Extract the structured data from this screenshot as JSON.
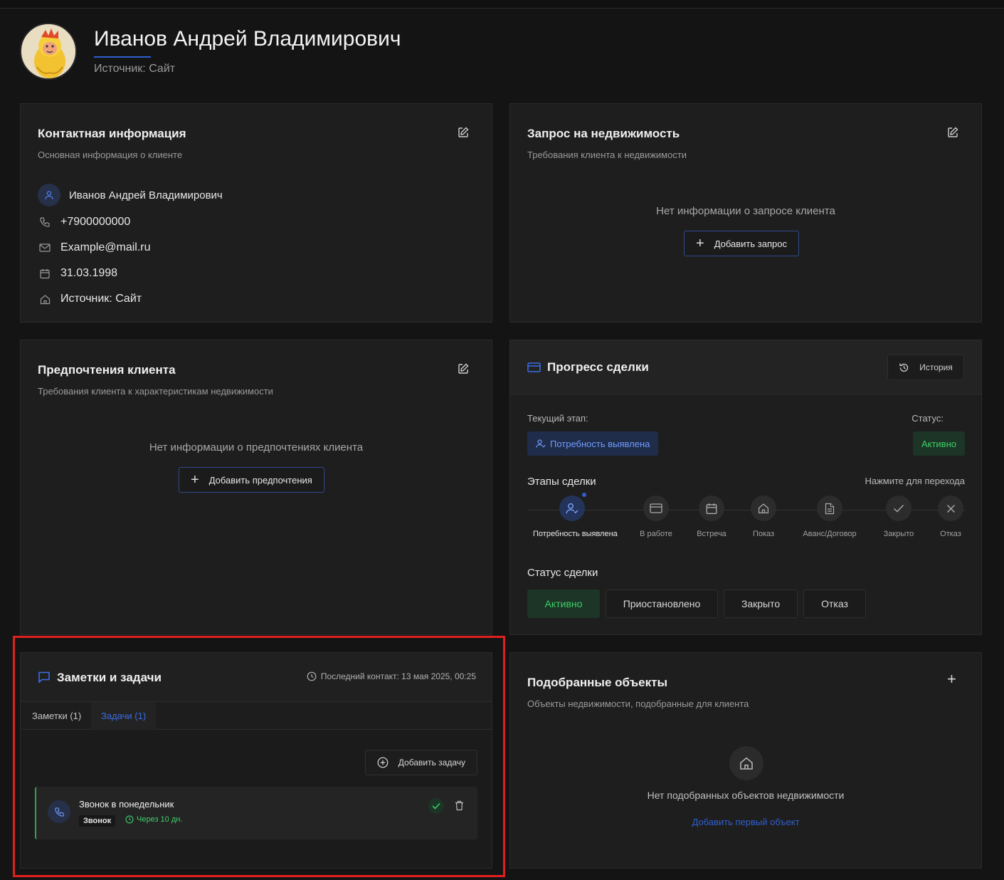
{
  "client": {
    "full_name": "Иванов Андрей Владимирович",
    "source_label": "Источник: Сайт"
  },
  "contact_card": {
    "title": "Контактная информация",
    "subtitle": "Основная информация о клиенте",
    "name": "Иванов Андрей Владимирович",
    "phone": "+7900000000",
    "email": "Example@mail.ru",
    "birthdate": "31.03.1998",
    "source": "Источник: Сайт"
  },
  "request_card": {
    "title": "Запрос на недвижимость",
    "subtitle": "Требования клиента к недвижимости",
    "empty_text": "Нет информации о запросе клиента",
    "add_label": "Добавить запрос"
  },
  "prefs_card": {
    "title": "Предпочтения клиента",
    "subtitle": "Требования клиента к характеристикам недвижимости",
    "empty_text": "Нет информации о предпочтениях клиента",
    "add_label": "Добавить предпочтения"
  },
  "progress_card": {
    "title": "Прогресс сделки",
    "history_label": "История",
    "current_stage_label": "Текущий этап:",
    "current_stage_value": "Потребность выявлена",
    "status_label": "Статус:",
    "status_value": "Активно",
    "stages_title": "Этапы сделки",
    "stages_hint": "Нажмите для перехода",
    "stages": [
      {
        "label": "Потребность выявлена",
        "icon": "user-check-icon",
        "active": true
      },
      {
        "label": "В работе",
        "icon": "card-icon",
        "active": false
      },
      {
        "label": "Встреча",
        "icon": "calendar-icon",
        "active": false
      },
      {
        "label": "Показ",
        "icon": "home-icon",
        "active": false
      },
      {
        "label": "Аванс/Договор",
        "icon": "document-icon",
        "active": false
      },
      {
        "label": "Закрыто",
        "icon": "check-icon",
        "active": false
      },
      {
        "label": "Отказ",
        "icon": "close-icon",
        "active": false
      }
    ],
    "deal_status_title": "Статус сделки",
    "deal_statuses": [
      "Активно",
      "Приостановлено",
      "Закрыто",
      "Отказ"
    ]
  },
  "notes_card": {
    "title": "Заметки и задачи",
    "last_contact": "Последний контакт: 13 мая 2025, 00:25",
    "tabs": [
      "Заметки (1)",
      "Задачи (1)"
    ],
    "active_tab": 1,
    "add_task_label": "Добавить задачу",
    "task": {
      "title": "Звонок в понедельник",
      "type": "Звонок",
      "due": "Через 10 дн."
    }
  },
  "objects_card": {
    "title": "Подобранные объекты",
    "subtitle": "Объекты недвижимости, подобранные для клиента",
    "empty_text": "Нет подобранных объектов недвижимости",
    "add_first_label": "Добавить первый объект"
  },
  "colors": {
    "accent": "#2f5fd0",
    "success": "#3ecf6a",
    "highlight_box": "#e0201e"
  }
}
